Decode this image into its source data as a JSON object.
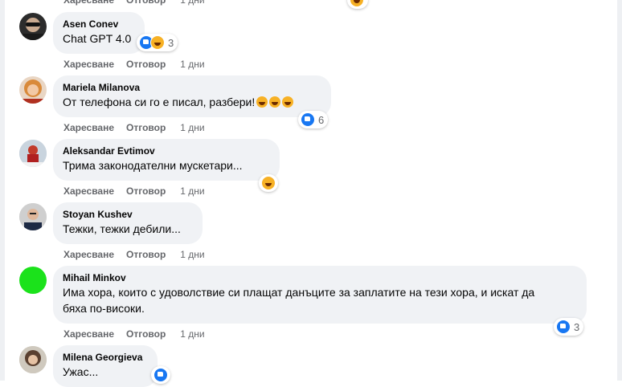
{
  "actions": {
    "like_label": "Харесване",
    "reply_label": "Отговор",
    "time_label": "1 дни"
  },
  "comments": [
    {
      "author": "Asen Conev",
      "text": "Chat GPT 4.0",
      "reaction_count": "3"
    },
    {
      "author": "Mariela Milanova",
      "text": "От телефона си го е писал, разбери!",
      "reaction_count": "6"
    },
    {
      "author": "Aleksandar Evtimov",
      "text": "Трима законодателни мускетари...",
      "reaction_count": ""
    },
    {
      "author": "Stoyan Kushev",
      "text": "Тежки, тежки дебили...",
      "reaction_count": ""
    },
    {
      "author": "Mihail Minkov",
      "text_line1": "Има хора, които с удоволствие си плащат данъците за заплатите на тези хора, и искат да",
      "text_line2": "бяха по-високи.",
      "reaction_count": "3"
    },
    {
      "author": "Milena Georgieva",
      "text": "Ужас...",
      "reaction_count": ""
    }
  ],
  "colors": {
    "bubble": "#f0f2f5",
    "like": "#1877f2",
    "haha": "#f7b125",
    "avatar_green": "#1be21b"
  }
}
